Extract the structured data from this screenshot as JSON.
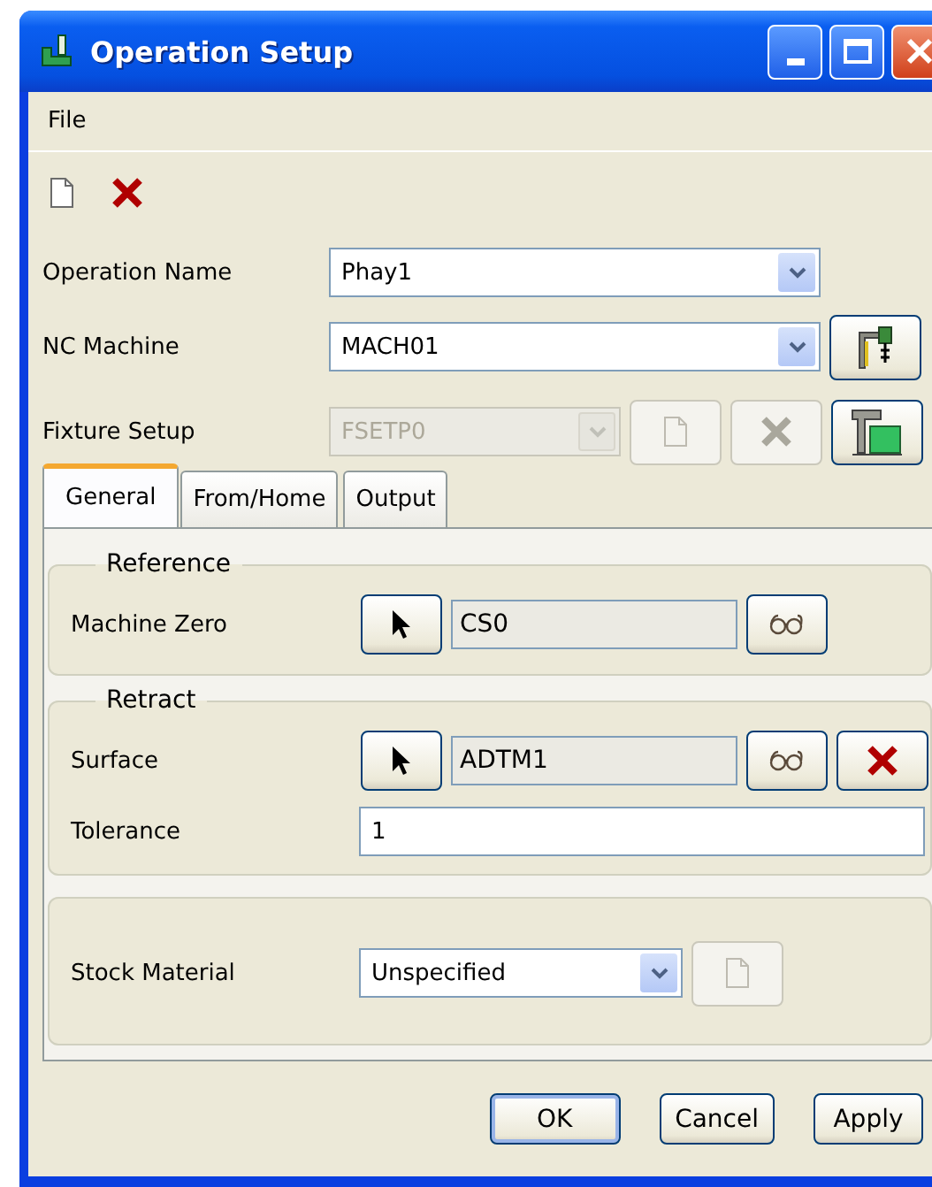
{
  "window": {
    "title": "Operation Setup"
  },
  "menu": [
    {
      "label": "File"
    }
  ],
  "toolbar": [
    {
      "kind": "new"
    },
    {
      "kind": "delete"
    }
  ],
  "fields": [
    {
      "label": "Operation Name",
      "value": "Phay1",
      "disabled": false
    },
    {
      "label": "NC Machine",
      "value": "MACH01",
      "disabled": false,
      "buttons": [
        {
          "kind": "machine",
          "disabled": false
        }
      ]
    },
    {
      "label": "Fixture Setup",
      "value": "FSETP0",
      "disabled": true,
      "buttons": [
        {
          "kind": "new",
          "disabled": true
        },
        {
          "kind": "delete",
          "disabled": true
        },
        {
          "kind": "fixture",
          "disabled": false
        }
      ]
    }
  ],
  "tabs": [
    {
      "label": "General",
      "selected": true
    },
    {
      "label": "From/Home",
      "selected": false
    },
    {
      "label": "Output",
      "selected": false
    }
  ],
  "groups": [
    {
      "title": "Reference",
      "rows": [
        {
          "kind": "reference",
          "label": "Machine Zero",
          "value": "CS0",
          "buttons": [
            {
              "kind": "pick",
              "disabled": false
            },
            {
              "kind": "view",
              "disabled": false
            }
          ]
        }
      ]
    },
    {
      "title": "Retract",
      "rows": [
        {
          "kind": "reference",
          "label": "Surface",
          "value": "ADTM1",
          "buttons": [
            {
              "kind": "pick",
              "disabled": false
            },
            {
              "kind": "view",
              "disabled": false
            },
            {
              "kind": "delete",
              "disabled": false
            }
          ]
        },
        {
          "kind": "text",
          "label": "Tolerance",
          "value": "1"
        }
      ]
    },
    {
      "rows": [
        {
          "kind": "combo",
          "label": "Stock Material",
          "value": "Unspecified",
          "buttons": [
            {
              "kind": "new",
              "disabled": true
            }
          ]
        }
      ]
    }
  ],
  "buttons": [
    {
      "label": "OK",
      "default": true
    },
    {
      "label": "Cancel",
      "default": false
    },
    {
      "label": "Apply",
      "default": false
    }
  ]
}
